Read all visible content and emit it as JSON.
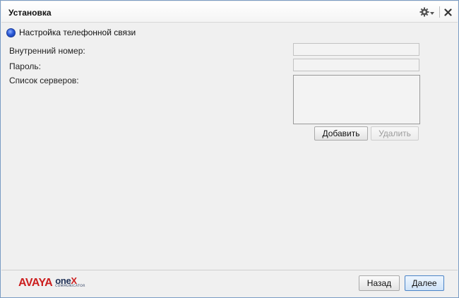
{
  "window": {
    "title": "Установка"
  },
  "title_controls": {
    "settings_icon": "gear-dropdown-icon",
    "close_icon": "close-x-icon"
  },
  "section": {
    "label": "Настройка телефонной связи",
    "marker_color": "#2b5ad8"
  },
  "form": {
    "extension_label": "Внутренний номер:",
    "extension_value": "",
    "password_label": "Пароль:",
    "password_value": "",
    "servers_label": "Список серверов:",
    "servers": []
  },
  "buttons": {
    "add": "Добавить",
    "remove": "Удалить",
    "back": "Назад",
    "next": "Далее"
  },
  "logo": {
    "brand": "AVAYA",
    "product_prefix": "one",
    "product_x": "X",
    "tagline": "COMMUNICATOR",
    "brand_color": "#cc1f1f"
  }
}
